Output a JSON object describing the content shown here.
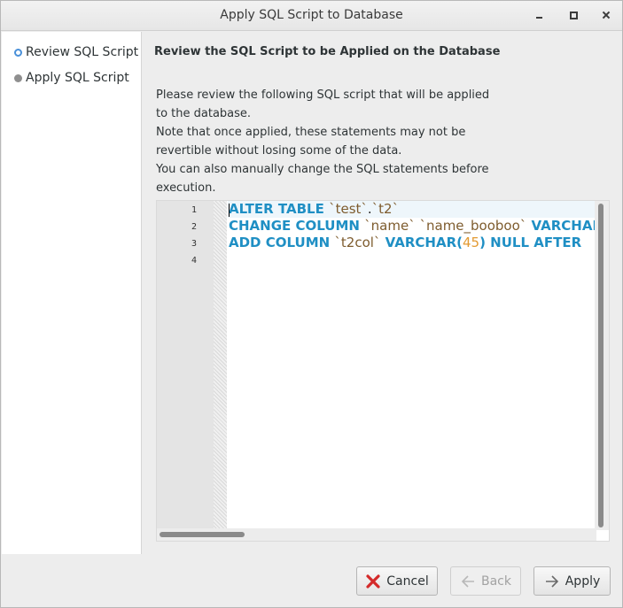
{
  "window": {
    "title": "Apply SQL Script to Database"
  },
  "sidebar": {
    "steps": [
      {
        "label": "Review SQL Script",
        "active": true
      },
      {
        "label": "Apply SQL Script",
        "active": false
      }
    ]
  },
  "main": {
    "heading": "Review the SQL Script to be Applied on the Database",
    "description_lines": [
      "Please review the following SQL script that will be applied",
      "to the database.",
      "Note that once applied, these statements may not be",
      "revertible without losing some of the data.",
      "You can also manually change the SQL statements before",
      "execution."
    ]
  },
  "editor": {
    "line_numbers": [
      "1",
      "2",
      "3",
      "4"
    ],
    "lines": [
      [
        {
          "t": "ALTER TABLE ",
          "k": "kw"
        },
        {
          "t": "`test`",
          "k": "id"
        },
        {
          "t": ".",
          "k": "pn"
        },
        {
          "t": "`t2`",
          "k": "id"
        }
      ],
      [
        {
          "t": "CHANGE COLUMN ",
          "k": "kw"
        },
        {
          "t": "`name`",
          "k": "id"
        },
        {
          "t": " ",
          "k": "pn"
        },
        {
          "t": "`name_booboo`",
          "k": "id"
        },
        {
          "t": " VARCHAR(",
          "k": "kw"
        }
      ],
      [
        {
          "t": "ADD COLUMN ",
          "k": "kw"
        },
        {
          "t": "`t2col`",
          "k": "id"
        },
        {
          "t": " VARCHAR(",
          "k": "kw"
        },
        {
          "t": "45",
          "k": "num"
        },
        {
          "t": ") NULL AFTER ",
          "k": "kw"
        }
      ],
      []
    ],
    "colors": {
      "keyword": "#1f8fc4",
      "identifier": "#7e5c2e",
      "number": "#e39a32"
    }
  },
  "buttons": {
    "cancel": {
      "label": "Cancel",
      "icon": "cancel-x-icon"
    },
    "back": {
      "label": "Back",
      "icon": "back-arrow-icon"
    },
    "apply": {
      "label": "Apply",
      "icon": "apply-arrow-icon"
    }
  }
}
